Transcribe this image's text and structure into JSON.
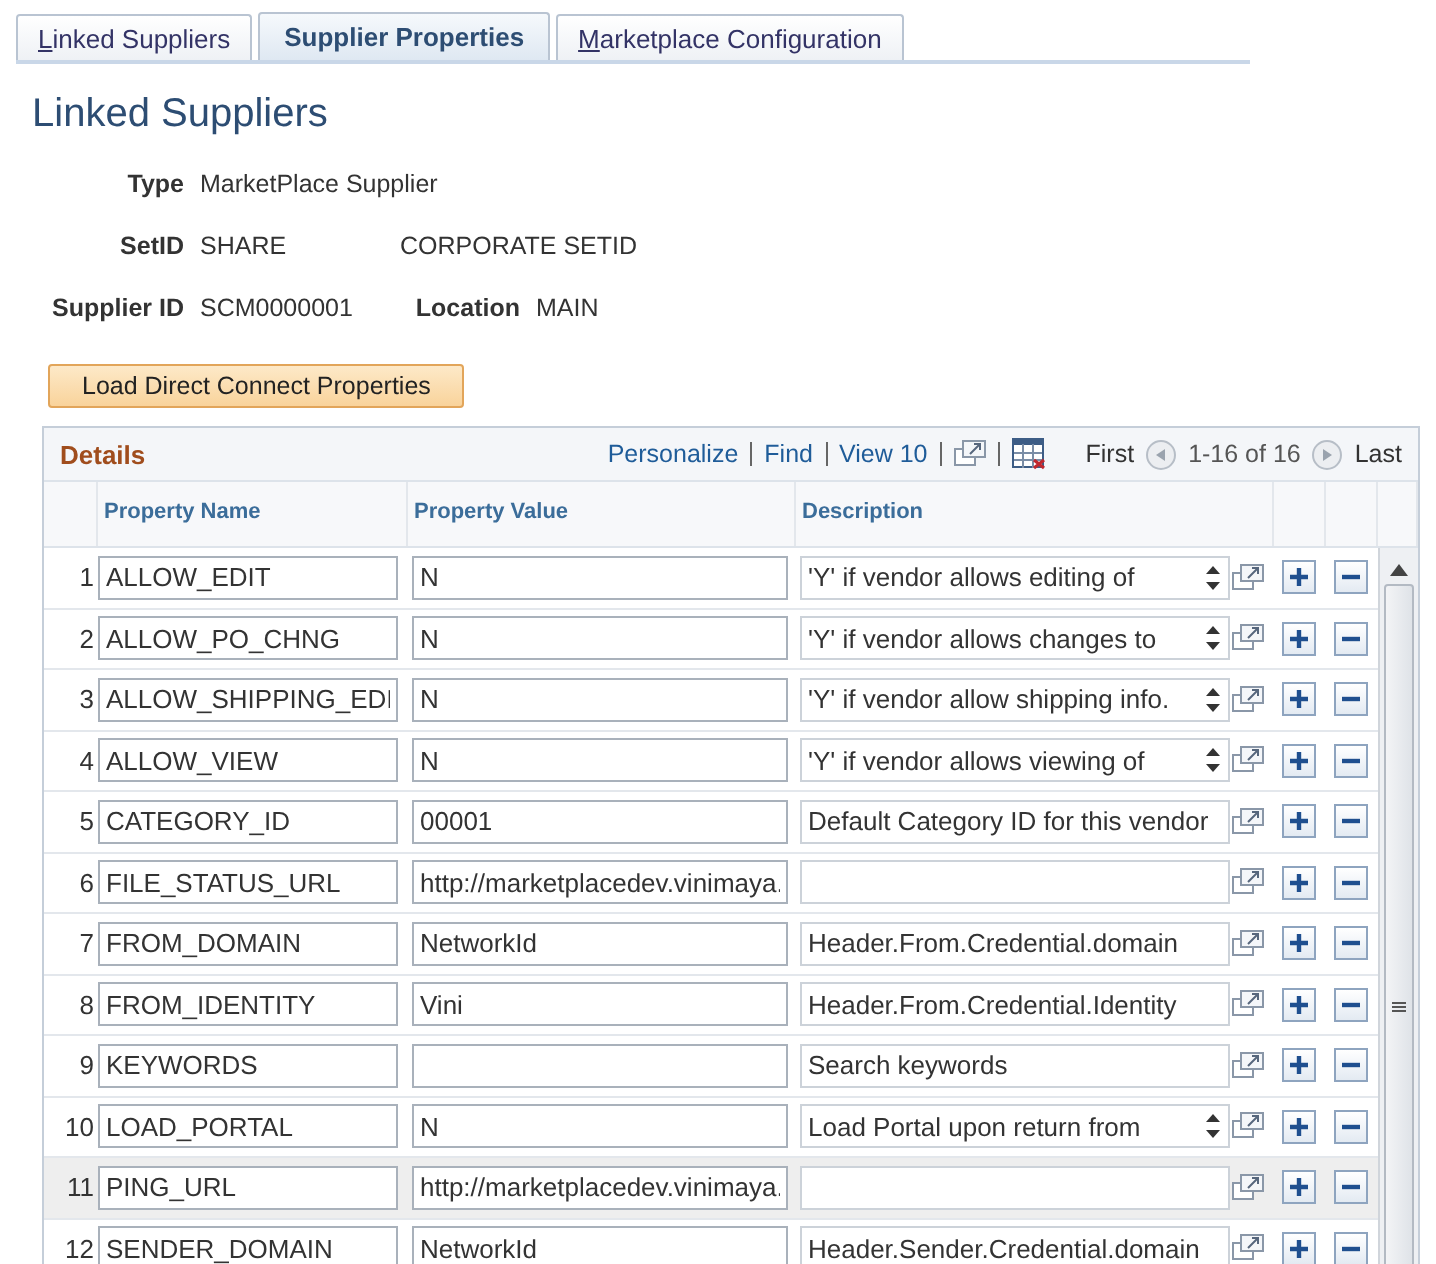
{
  "tabs": [
    {
      "label": "Linked Suppliers",
      "selected": false
    },
    {
      "label": "Supplier Properties",
      "selected": true
    },
    {
      "label": "Marketplace Configuration",
      "selected": false
    }
  ],
  "page_title": "Linked Suppliers",
  "summary": [
    {
      "items": [
        {
          "label": "Type",
          "value": "MarketPlace Supplier"
        }
      ]
    },
    {
      "items": [
        {
          "label": "SetID",
          "value": "SHARE"
        },
        {
          "value": "CORPORATE SETID"
        }
      ]
    },
    {
      "items": [
        {
          "label": "Supplier ID",
          "value": "SCM0000001"
        },
        {
          "label": "Location",
          "value": "MAIN"
        }
      ]
    }
  ],
  "load_button": "Load Direct Connect Properties",
  "grid": {
    "title": "Details",
    "links": [
      "Personalize",
      "Find",
      "View 10"
    ],
    "first": "First",
    "range": "1-16 of 16",
    "last": "Last",
    "columns": [
      "Property Name",
      "Property Value",
      "Description"
    ],
    "rows": [
      {
        "number": "1",
        "name": "ALLOW_EDIT",
        "value": "N",
        "description": "'Y' if vendor allows editing of",
        "scrollable": true,
        "selected": false
      },
      {
        "number": "2",
        "name": "ALLOW_PO_CHNG",
        "value": "N",
        "description": "'Y' if vendor allows changes to",
        "scrollable": true,
        "selected": false
      },
      {
        "number": "3",
        "name": "ALLOW_SHIPPING_EDI",
        "value": "N",
        "description": "'Y' if vendor allow shipping info.",
        "scrollable": true,
        "selected": false
      },
      {
        "number": "4",
        "name": "ALLOW_VIEW",
        "value": "N",
        "description": "'Y' if vendor allows viewing of",
        "scrollable": true,
        "selected": false
      },
      {
        "number": "5",
        "name": "CATEGORY_ID",
        "value": "00001",
        "description": "Default Category ID for this vendor",
        "scrollable": false,
        "selected": false
      },
      {
        "number": "6",
        "name": "FILE_STATUS_URL",
        "value": "http://marketplacedev.vinimaya.",
        "scrollable": false,
        "selected": false
      },
      {
        "number": "7",
        "name": "FROM_DOMAIN",
        "value": "NetworkId",
        "description": "Header.From.Credential.domain",
        "scrollable": false,
        "selected": false
      },
      {
        "number": "8",
        "name": "FROM_IDENTITY",
        "value": "Vini",
        "description": "Header.From.Credential.Identity",
        "scrollable": false,
        "selected": false
      },
      {
        "number": "9",
        "name": "KEYWORDS",
        "description": "Search keywords",
        "scrollable": false,
        "selected": false
      },
      {
        "number": "10",
        "name": "LOAD_PORTAL",
        "value": "N",
        "description": "Load Portal upon return from",
        "scrollable": true,
        "selected": false
      },
      {
        "number": "11",
        "name": "PING_URL",
        "value": "http://marketplacedev.vinimaya.",
        "scrollable": false,
        "selected": true
      },
      {
        "number": "12",
        "name": "SENDER_DOMAIN",
        "value": "NetworkId",
        "description": "Header.Sender.Credential.domain",
        "scrollable": false,
        "selected": false
      }
    ]
  }
}
